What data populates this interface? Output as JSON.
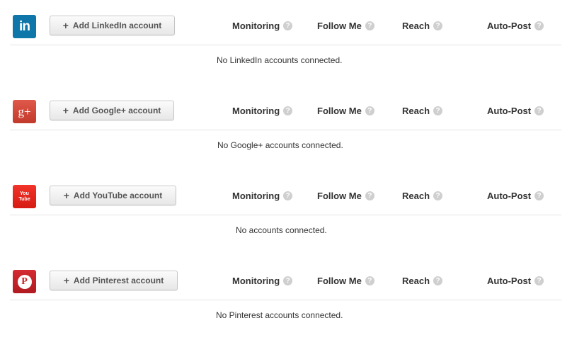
{
  "columns": {
    "monitoring": "Monitoring",
    "follow_me": "Follow Me",
    "reach": "Reach",
    "auto_post": "Auto-Post",
    "help_glyph": "?"
  },
  "sections": [
    {
      "network": "LinkedIn",
      "logo_text": "in",
      "brand_color": "#0e76a8",
      "add_label": "Add LinkedIn account",
      "empty_message": "No LinkedIn accounts connected."
    },
    {
      "network": "Google+",
      "logo_text": "g+",
      "brand_color": "#d34836",
      "add_label": "Add Google+ account",
      "empty_message": "No Google+ accounts connected."
    },
    {
      "network": "YouTube",
      "logo_text": "You Tube",
      "brand_color": "#e62117",
      "add_label": "Add YouTube account",
      "empty_message": "No accounts connected."
    },
    {
      "network": "Pinterest",
      "logo_text": "P",
      "brand_color": "#cb2027",
      "add_label": "Add Pinterest account",
      "empty_message": "No Pinterest accounts connected."
    }
  ],
  "icons": {
    "add": "+",
    "help": "question-circle-icon"
  }
}
